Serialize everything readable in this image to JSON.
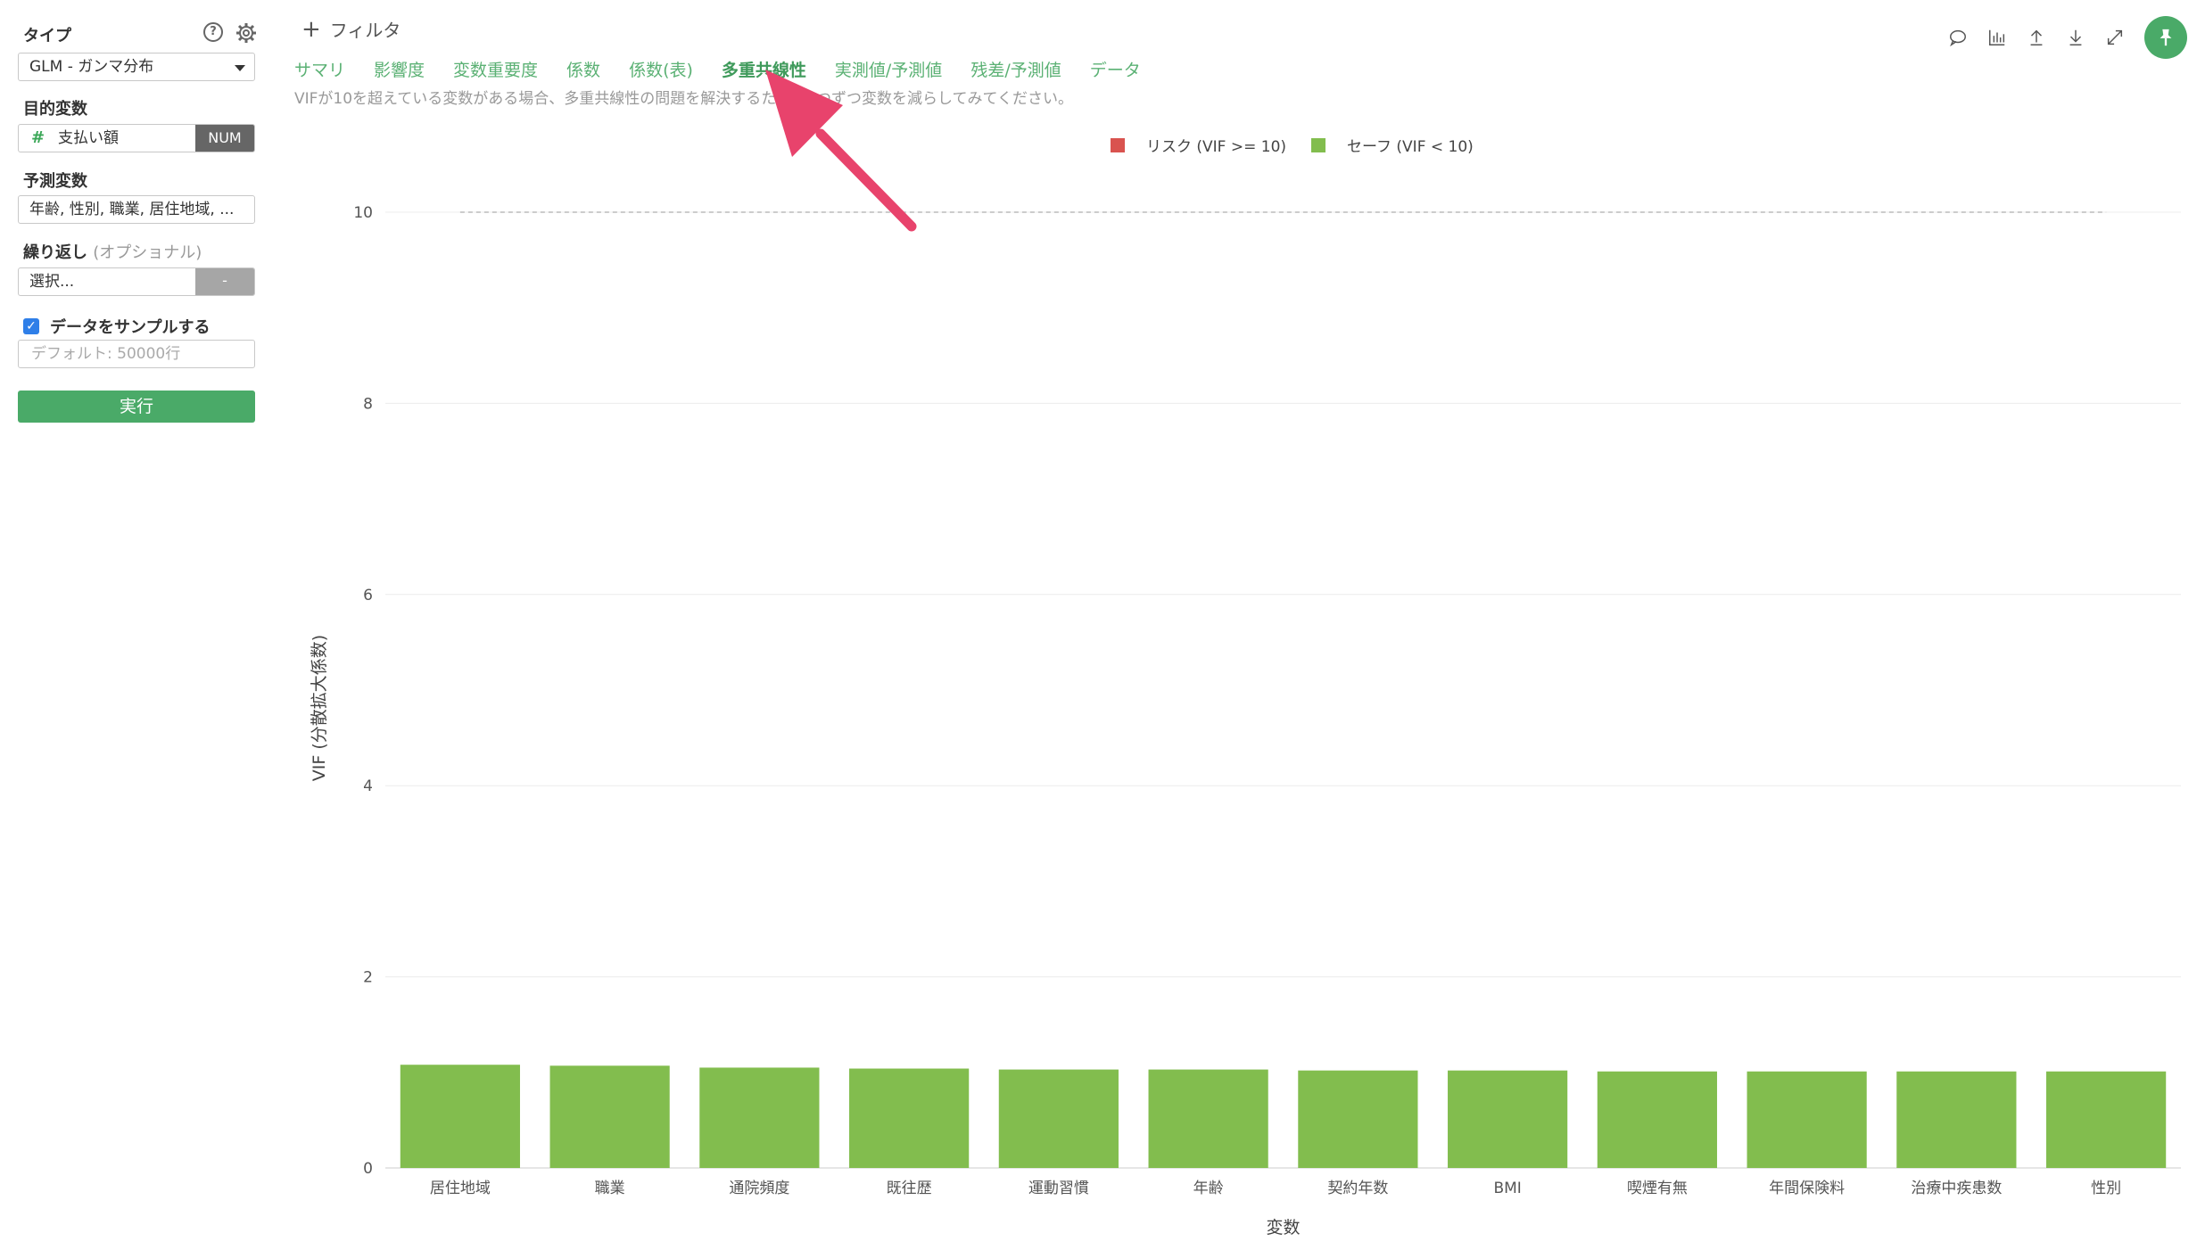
{
  "sidebar": {
    "type_label": "タイプ",
    "type_value": "GLM - ガンマ分布",
    "help_glyph": "?",
    "target_label": "目的変数",
    "target_value": "支払い額",
    "target_tag": "NUM",
    "target_prefix": "#",
    "predictor_label": "予測変数",
    "predictor_value": "年齢, 性別, 職業, 居住地域, ...",
    "repeat_label": "繰り返し",
    "repeat_optional": "(オプショナル)",
    "repeat_value": "選択...",
    "repeat_button": "-",
    "sample_checked": true,
    "sample_label": "データをサンプルする",
    "sample_placeholder": "デフォルト: 50000行",
    "run_label": "実行"
  },
  "topbar": {
    "filter_plus": "+",
    "filter_label": "フィルタ"
  },
  "tabs": [
    {
      "label": "サマリ",
      "active": false
    },
    {
      "label": "影響度",
      "active": false
    },
    {
      "label": "変数重要度",
      "active": false
    },
    {
      "label": "係数",
      "active": false
    },
    {
      "label": "係数(表)",
      "active": false
    },
    {
      "label": "多重共線性",
      "active": true
    },
    {
      "label": "実測値/予測値",
      "active": false
    },
    {
      "label": "残差/予測値",
      "active": false
    },
    {
      "label": "データ",
      "active": false
    }
  ],
  "description": "VIFが10を超えている変数がある場合、多重共線性の問題を解決するために1つずつ変数を減らしてみてください。",
  "colors": {
    "accent": "#4aaa68",
    "risk": "#d9534f",
    "safe": "#82bd4e",
    "annotation_arrow": "#e8436c"
  },
  "chart_data": {
    "type": "bar",
    "xlabel": "変数",
    "ylabel": "VIF (分散拡大係数)",
    "ylim": [
      0,
      10
    ],
    "yticks": [
      0,
      2,
      4,
      6,
      8,
      10
    ],
    "threshold": 10,
    "legend_position": "top-center",
    "legend": [
      {
        "label": "リスク (VIF >= 10)",
        "color": "#d9534f"
      },
      {
        "label": "セーフ (VIF < 10)",
        "color": "#82bd4e"
      }
    ],
    "grid": true,
    "categories": [
      "居住地域",
      "職業",
      "通院頻度",
      "既往歴",
      "運動習慣",
      "年齢",
      "契約年数",
      "BMI",
      "喫煙有無",
      "年間保険料",
      "治療中疾患数",
      "性別"
    ],
    "values": [
      1.08,
      1.07,
      1.05,
      1.04,
      1.03,
      1.03,
      1.02,
      1.02,
      1.01,
      1.01,
      1.01,
      1.01
    ]
  }
}
